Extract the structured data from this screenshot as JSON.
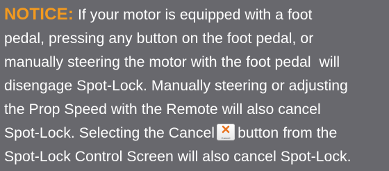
{
  "notice": {
    "label": "NOTICE:",
    "line1_rest": " If your motor is equipped with a foot",
    "line2": "pedal, pressing any button on the foot pedal, or",
    "line3": "manually steering the motor with the foot pedal  will",
    "line4": "disengage Spot-Lock. Manually steering or adjusting",
    "line5": "the Prop Speed with the Remote will also cancel",
    "line6_before_icon": "Spot-Lock. Selecting the Cancel",
    "line6_after_icon": "button from the",
    "line7": "Spot-Lock Control Screen will also cancel Spot-Lock."
  },
  "cancel_icon": {
    "icon": "close-icon",
    "caption": "Cancel",
    "x_color": "#e8731f"
  },
  "colors": {
    "background": "#68686d",
    "label": "#f39a1f",
    "text": "#ffffff"
  }
}
